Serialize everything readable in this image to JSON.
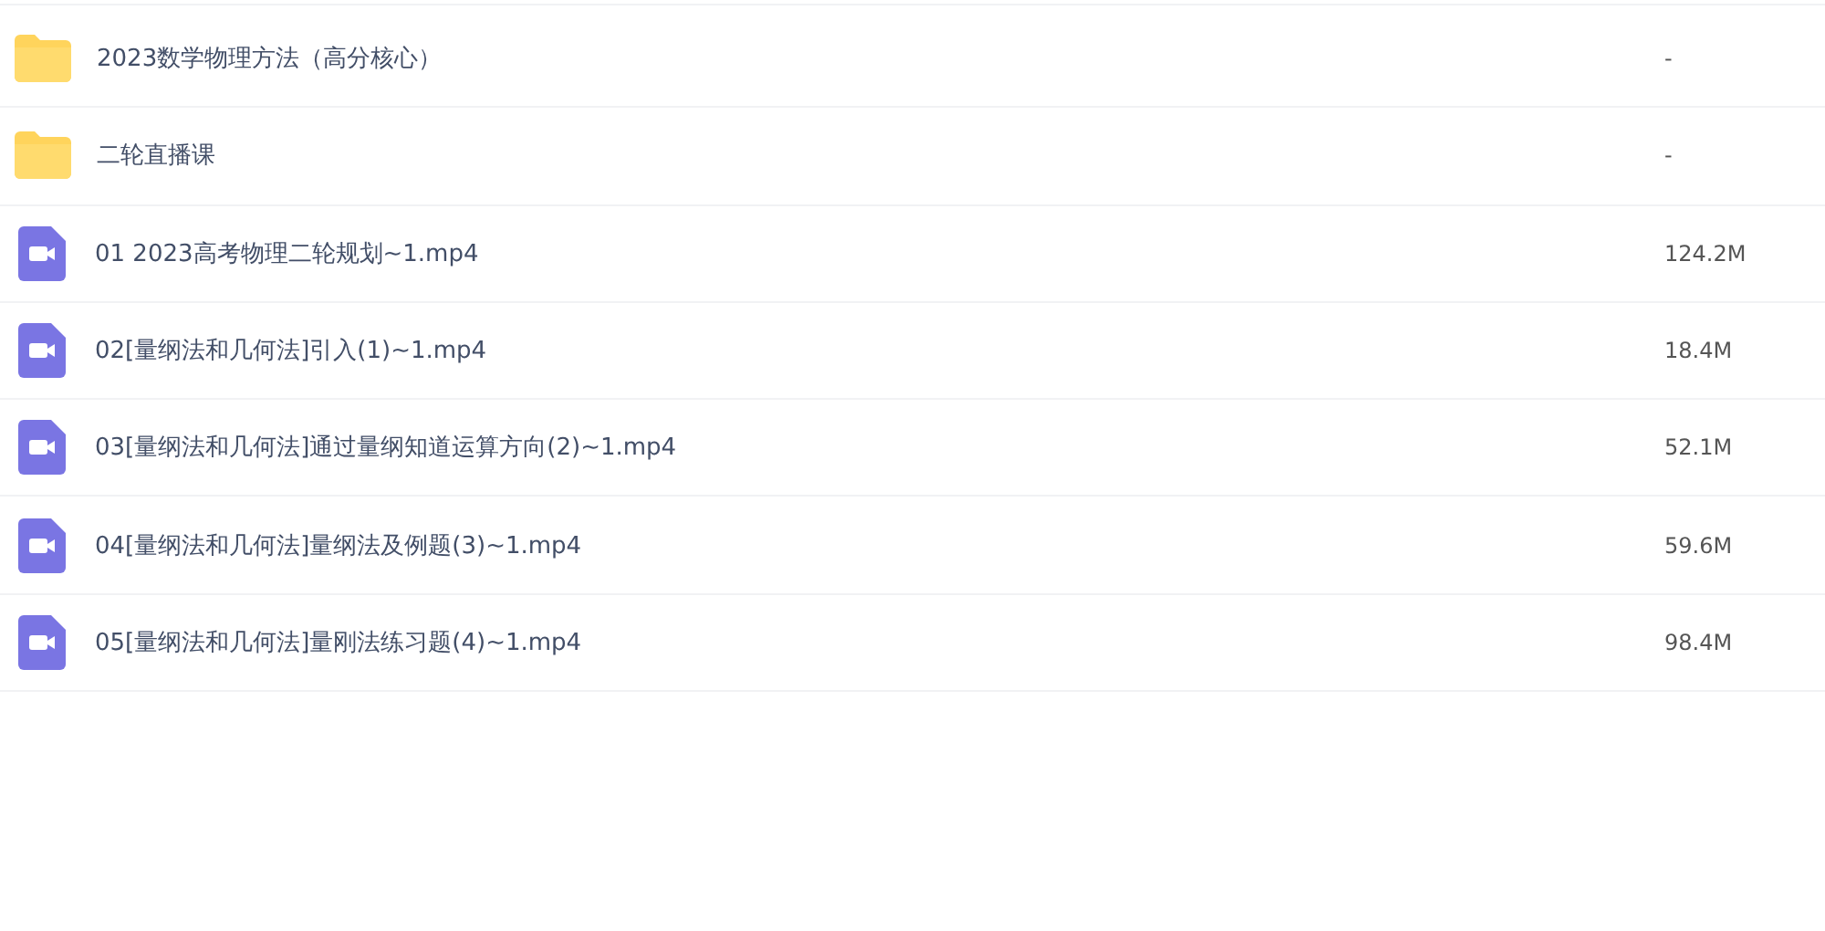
{
  "files": [
    {
      "kind": "folder",
      "name": "2023数学物理方法（高分核心）",
      "size": "-"
    },
    {
      "kind": "folder",
      "name": "二轮直播课",
      "size": "-"
    },
    {
      "kind": "video",
      "name": "01 2023高考物理二轮规划~1.mp4",
      "size": "124.2M"
    },
    {
      "kind": "video",
      "name": "02[量纲法和几何法]引入(1)~1.mp4",
      "size": "18.4M"
    },
    {
      "kind": "video",
      "name": "03[量纲法和几何法]通过量纲知道运算方向(2)~1.mp4",
      "size": "52.1M"
    },
    {
      "kind": "video",
      "name": "04[量纲法和几何法]量纲法及例题(3)~1.mp4",
      "size": "59.6M"
    },
    {
      "kind": "video",
      "name": "05[量纲法和几何法]量刚法练习题(4)~1.mp4",
      "size": "98.4M"
    }
  ]
}
